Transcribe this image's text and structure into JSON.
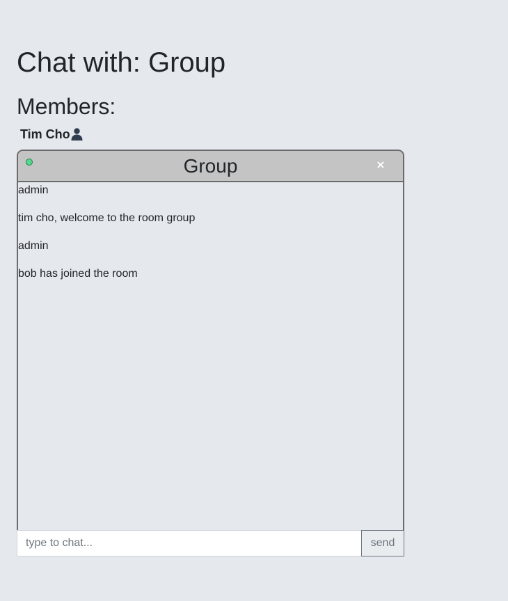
{
  "page": {
    "title": "Chat with: Group"
  },
  "members": {
    "heading": "Members:",
    "list": [
      {
        "name": "Tim Cho",
        "icon": "user-icon"
      }
    ]
  },
  "chat": {
    "title": "Group",
    "status": "online",
    "status_color": "#58d68d",
    "header_color": "#c4c4c4",
    "close_label": "×",
    "messages": [
      "admin",
      "tim cho, welcome to the room group",
      "admin",
      "bob has joined the room"
    ],
    "input": {
      "value": "",
      "placeholder": "type to chat..."
    },
    "send_label": "send"
  }
}
